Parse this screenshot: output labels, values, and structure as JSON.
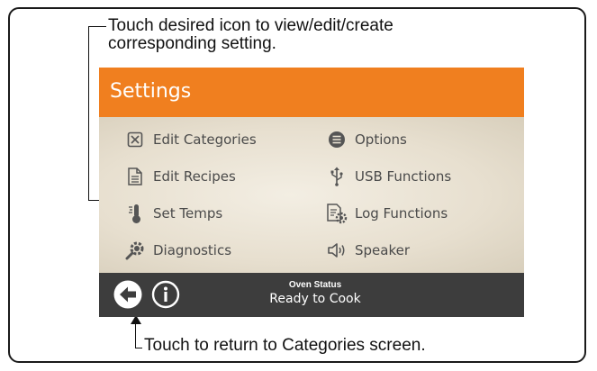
{
  "callouts": {
    "top_line1": "Touch desired icon to view/edit/create",
    "top_line2": "corresponding setting.",
    "bottom": "Touch to return to Categories screen."
  },
  "header": {
    "title": "Settings"
  },
  "menu": {
    "edit_categories": {
      "label": "Edit Categories",
      "icon": "close-box-icon"
    },
    "edit_recipes": {
      "label": "Edit Recipes",
      "icon": "document-icon"
    },
    "set_temps": {
      "label": "Set Temps",
      "icon": "thermometer-icon"
    },
    "diagnostics": {
      "label": "Diagnostics",
      "icon": "gear-wrench-icon"
    },
    "options": {
      "label": "Options",
      "icon": "list-circle-icon"
    },
    "usb_functions": {
      "label": "USB Functions",
      "icon": "usb-icon"
    },
    "log_functions": {
      "label": "Log Functions",
      "icon": "log-gear-icon"
    },
    "speaker": {
      "label": "Speaker",
      "icon": "speaker-icon"
    }
  },
  "footer": {
    "status_label": "Oven Status",
    "status_value": "Ready to Cook"
  },
  "colors": {
    "header": "#f07f1f",
    "footer": "#3d3d3d",
    "text": "#4a4a4a"
  }
}
